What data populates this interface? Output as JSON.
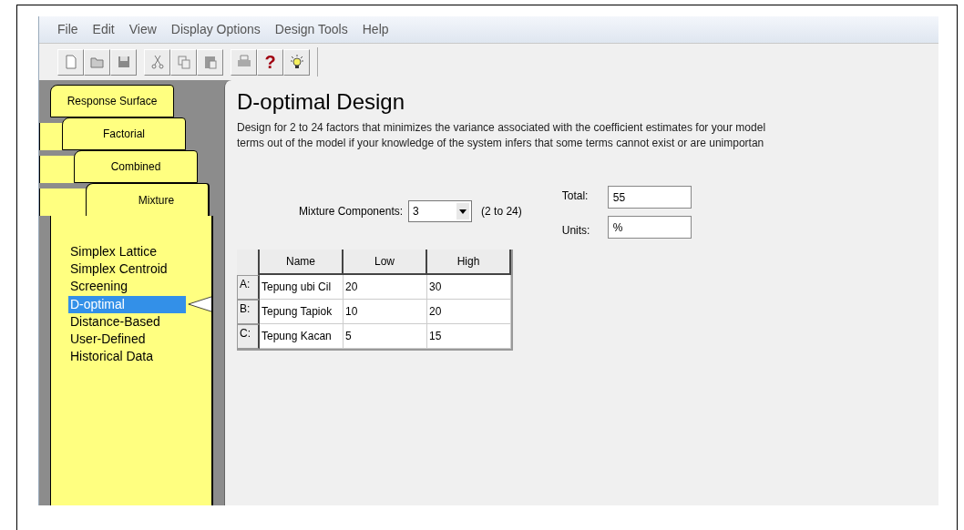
{
  "menu": [
    "File",
    "Edit",
    "View",
    "Display Options",
    "Design Tools",
    "Help"
  ],
  "toolbar": [
    {
      "kind": "new"
    },
    {
      "kind": "open"
    },
    {
      "kind": "save"
    },
    {
      "kind": "sep"
    },
    {
      "kind": "cut"
    },
    {
      "kind": "copy"
    },
    {
      "kind": "paste"
    },
    {
      "kind": "sep"
    },
    {
      "kind": "print"
    },
    {
      "kind": "help",
      "label": "?"
    },
    {
      "kind": "tip"
    }
  ],
  "tabs": [
    {
      "label": "Response Surface",
      "selected": false
    },
    {
      "label": "Factorial",
      "selected": false
    },
    {
      "label": "Combined",
      "selected": false
    },
    {
      "label": "Mixture",
      "selected": true
    }
  ],
  "design_types": [
    {
      "label": "Simplex Lattice",
      "selected": false
    },
    {
      "label": "Simplex Centroid",
      "selected": false
    },
    {
      "label": "Screening",
      "selected": false
    },
    {
      "label": "D-optimal",
      "selected": true
    },
    {
      "label": "Distance-Based",
      "selected": false
    },
    {
      "label": "User-Defined",
      "selected": false
    },
    {
      "label": "Historical Data",
      "selected": false
    }
  ],
  "title": "D-optimal Design",
  "description": [
    "Design for 2 to 24 factors that minimizes the variance associated with the coefficient estimates for your model",
    "terms out of the model if your knowledge of the system infers that some terms cannot exist or are unimportan"
  ],
  "components": {
    "label": "Mixture Components:",
    "value": "3",
    "range": "(2 to 24)"
  },
  "total": {
    "label": "Total:",
    "value": "55"
  },
  "units": {
    "label": "Units:",
    "value": "%"
  },
  "table": {
    "columns": [
      "Name",
      "Low",
      "High"
    ],
    "rows": [
      {
        "label": "A:",
        "cells": [
          "Tepung ubi Cil",
          "20",
          "30"
        ]
      },
      {
        "label": "B:",
        "cells": [
          "Tepung Tapiok",
          "10",
          "20"
        ]
      },
      {
        "label": "C:",
        "cells": [
          "Tepung Kacan",
          "5",
          "15"
        ]
      }
    ]
  }
}
